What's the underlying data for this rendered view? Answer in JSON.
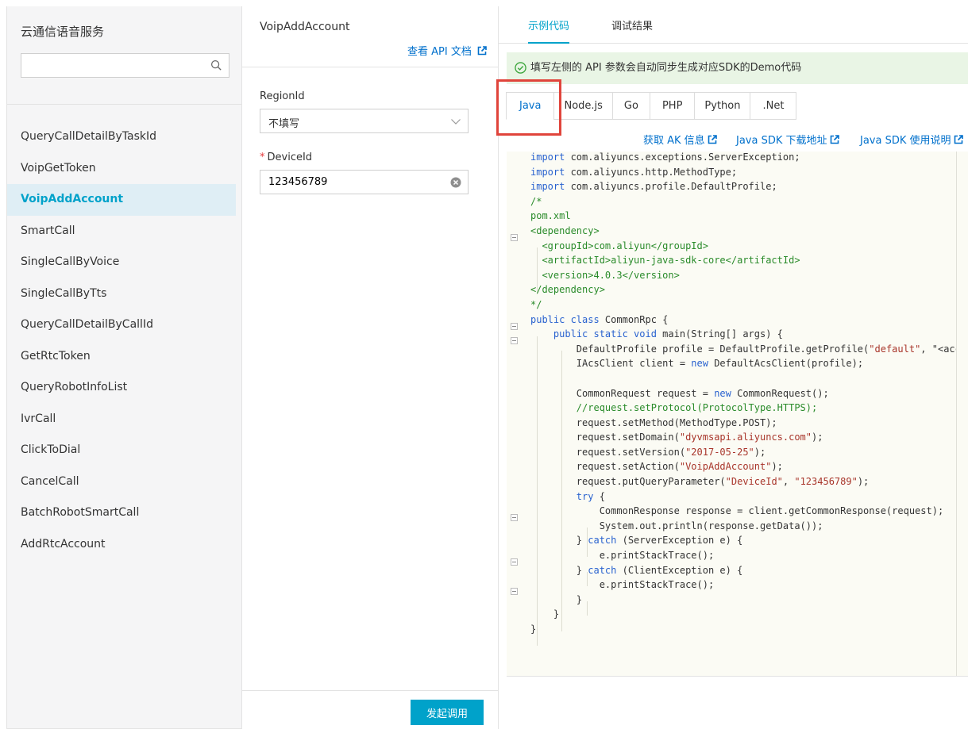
{
  "sidebar": {
    "title": "云通信语音服务",
    "search": {
      "value": "",
      "placeholder": ""
    },
    "items": [
      {
        "label": "QueryCallDetailByTaskId",
        "active": false
      },
      {
        "label": "VoipGetToken",
        "active": false
      },
      {
        "label": "VoipAddAccount",
        "active": true
      },
      {
        "label": "SmartCall",
        "active": false
      },
      {
        "label": "SingleCallByVoice",
        "active": false
      },
      {
        "label": "SingleCallByTts",
        "active": false
      },
      {
        "label": "QueryCallDetailByCallId",
        "active": false
      },
      {
        "label": "GetRtcToken",
        "active": false
      },
      {
        "label": "QueryRobotInfoList",
        "active": false
      },
      {
        "label": "IvrCall",
        "active": false
      },
      {
        "label": "ClickToDial",
        "active": false
      },
      {
        "label": "CancelCall",
        "active": false
      },
      {
        "label": "BatchRobotSmartCall",
        "active": false
      },
      {
        "label": "AddRtcAccount",
        "active": false
      }
    ]
  },
  "form": {
    "title": "VoipAddAccount",
    "api_doc_link": "查看 API 文档",
    "region_label": "RegionId",
    "region_value": "不填写",
    "device_label": "DeviceId",
    "device_value": "123456789",
    "submit_label": "发起调用"
  },
  "code_panel": {
    "tabs": [
      "示例代码",
      "调试结果"
    ],
    "notice": "填写左侧的 API 参数会自动同步生成对应SDK的Demo代码",
    "languages": [
      "Java",
      "Node.js",
      "Go",
      "PHP",
      "Python",
      ".Net"
    ],
    "active_language": "Java",
    "links": [
      "获取 AK 信息",
      "Java SDK 下载地址",
      "Java SDK 使用说明"
    ]
  },
  "colors": {
    "accent": "#00a2ca",
    "link": "#0070cc",
    "highlight": "#e0443b",
    "notice_bg": "#e9f5e5"
  }
}
